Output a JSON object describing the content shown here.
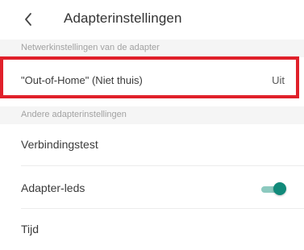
{
  "header": {
    "back_icon": "chevron-left-icon",
    "title": "Adapterinstellingen"
  },
  "sections": {
    "network_header": "Netwerkinstellingen van de adapter",
    "other_header": "Andere adapterinstellingen"
  },
  "out_of_home": {
    "label": "\"Out-of-Home\" (Niet thuis)",
    "value": "Uit"
  },
  "connection_test": {
    "label": "Verbindingstest"
  },
  "adapter_leds": {
    "label": "Adapter-leds",
    "toggle_on": true
  },
  "time": {
    "label": "Tijd"
  },
  "colors": {
    "highlight": "#e0202a",
    "toggle_accent": "#118a7a"
  }
}
